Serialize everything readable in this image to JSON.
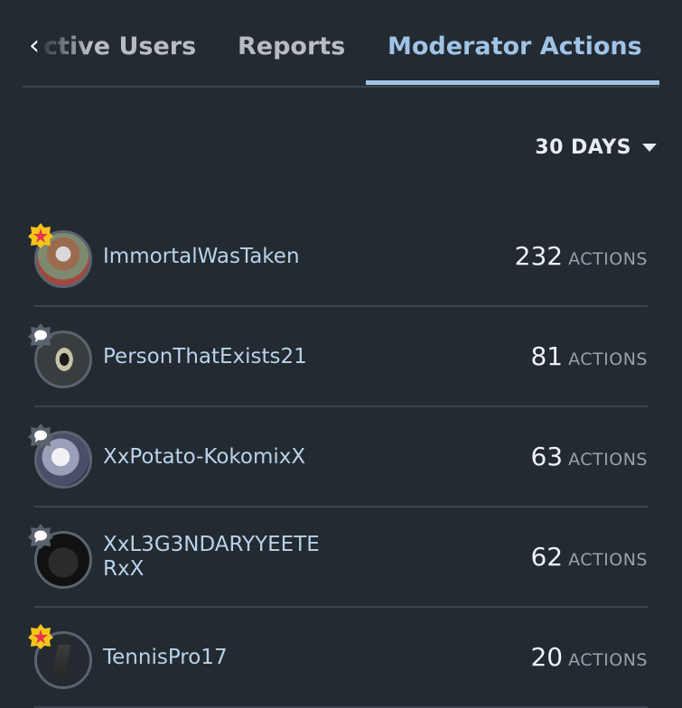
{
  "tabs": {
    "items": [
      {
        "label": "ctive Users"
      },
      {
        "label": "Reports"
      },
      {
        "label": "Moderator Actions"
      }
    ],
    "active_index": 2
  },
  "filter": {
    "label": "30 DAYS"
  },
  "moderators": [
    {
      "name": "ImmortalWasTaken",
      "count": "232",
      "unit": "ACTIONS",
      "badge": "star-badge-icon"
    },
    {
      "name": "PersonThatExists21",
      "count": "81",
      "unit": "ACTIONS",
      "badge": "chat-badge-icon"
    },
    {
      "name": "XxPotato-KokomixX",
      "count": "63",
      "unit": "ACTIONS",
      "badge": "chat-badge-icon"
    },
    {
      "name_line1": "XxL3G3NDARYYEETE",
      "name_line2": "RxX",
      "count": "62",
      "unit": "ACTIONS",
      "badge": "chat-badge-icon"
    },
    {
      "name": "TennisPro17",
      "count": "20",
      "unit": "ACTIONS",
      "badge": "star-badge-icon"
    }
  ],
  "colors": {
    "background": "#232a31",
    "accent": "#9fc3e6",
    "name_text": "#b9d2ea",
    "star_badge": "#f5c518",
    "star": "#e8344e"
  }
}
